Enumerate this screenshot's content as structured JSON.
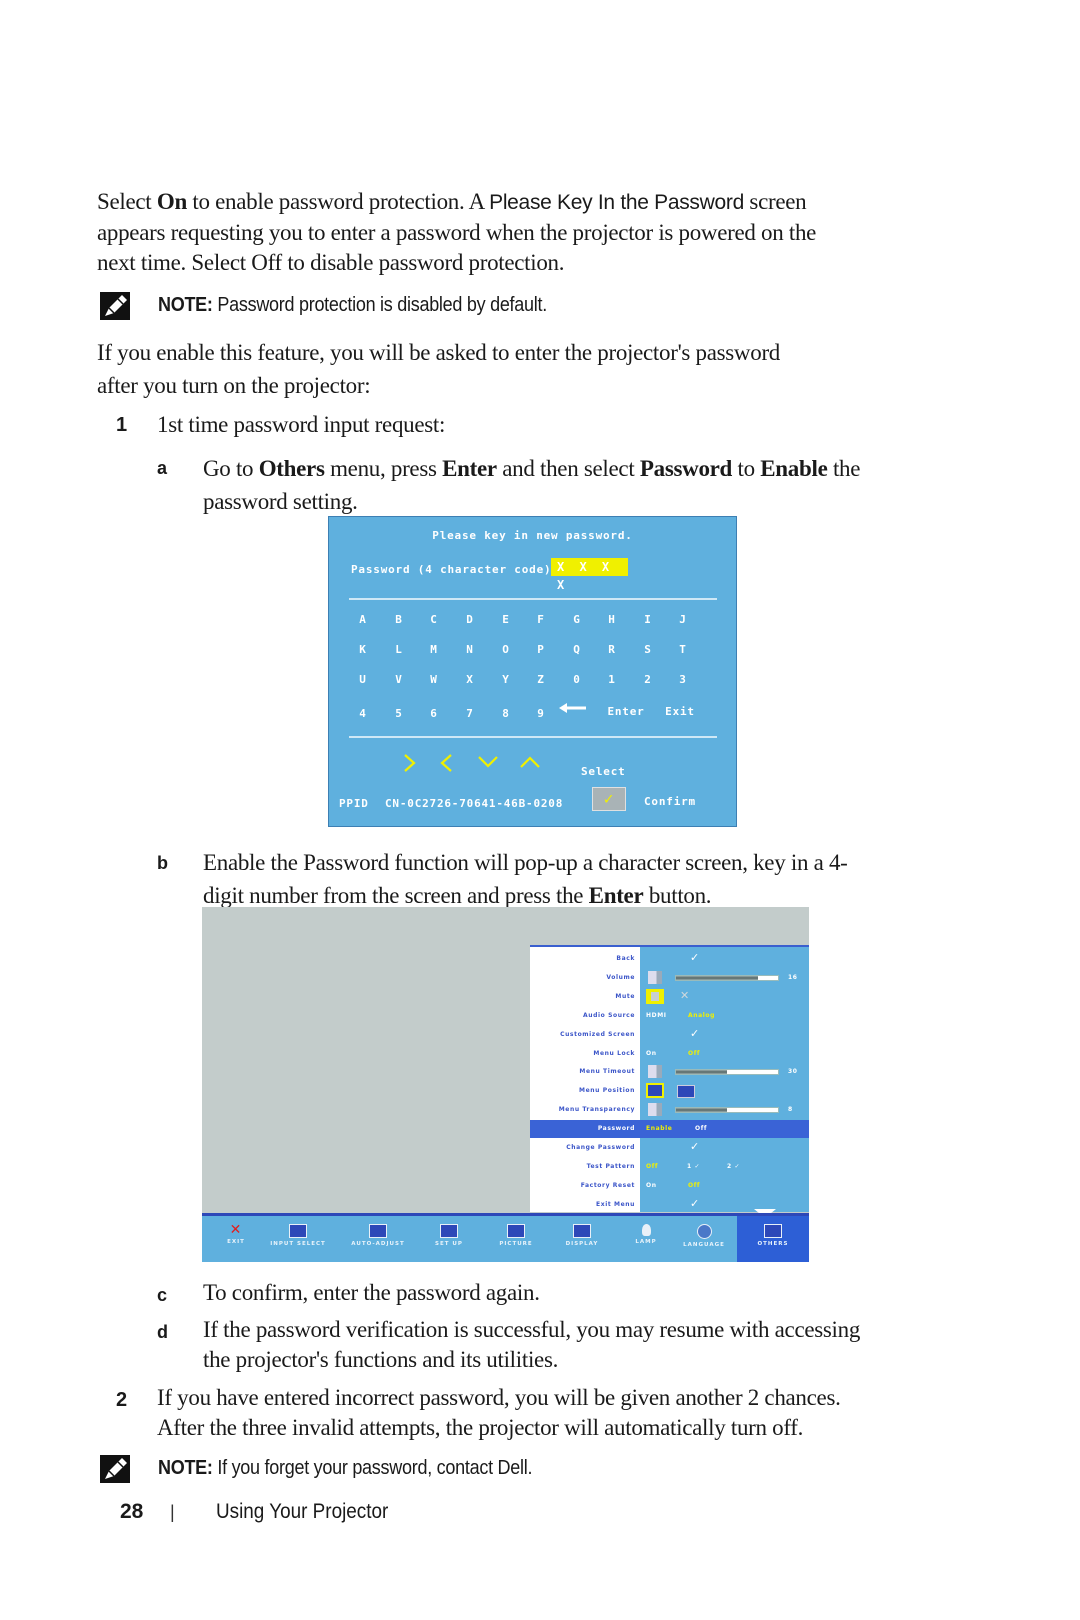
{
  "intro": {
    "line1_pre": "Select ",
    "line1_on": "On",
    "line1_mid": " to enable password protection. A ",
    "line1_ui": "Please Key In the Password",
    "line1_post": " screen",
    "line2": "appears requesting you to enter a password when the projector is powered on the",
    "line3": "next time. Select Off  to disable password protection."
  },
  "note1": {
    "label": "NOTE:",
    "text": " Password protection is disabled by default.",
    "icon": "note-pencil-icon"
  },
  "para2": {
    "line1": "If you enable this feature, you will be asked to enter the projector's password",
    "line2": "after you turn on the projector:"
  },
  "step1": {
    "marker": "1",
    "text": "1st time password input request:",
    "a": {
      "marker": "a",
      "parts": [
        "Go to ",
        "Others",
        " menu, press ",
        "Enter",
        " and then select ",
        "Password",
        " to ",
        "Enable",
        " the"
      ],
      "line2": "password setting."
    },
    "b": {
      "marker": "b",
      "line1": "Enable the Password function will pop-up a character screen, key in a 4-",
      "line2_pre": "digit number from the screen and press the ",
      "line2_bold": "Enter",
      "line2_post": " button."
    },
    "c": {
      "marker": "c",
      "text": "To confirm, enter the password again."
    },
    "d": {
      "marker": "d",
      "line1": "If the password verification is successful, you may resume with accessing",
      "line2": "the projector's functions and its utilities."
    }
  },
  "step2": {
    "marker": "2",
    "line1": "If you have entered incorrect password, you will be given another 2 chances.",
    "line2": "After the three invalid attempts, the projector will automatically turn off."
  },
  "note2": {
    "label": "NOTE:",
    "text": " If you forget your password, contact Dell.",
    "icon": "note-pencil-icon"
  },
  "footer": {
    "page": "28",
    "separator": "|",
    "section": "Using Your Projector"
  },
  "password_dialog": {
    "title": "Please key in new password.",
    "field_label": "Password (4 character code):",
    "field_value": "X X X X",
    "keys": [
      [
        "A",
        "B",
        "C",
        "D",
        "E",
        "F",
        "G",
        "H",
        "I",
        "J"
      ],
      [
        "K",
        "L",
        "M",
        "N",
        "O",
        "P",
        "Q",
        "R",
        "S",
        "T"
      ],
      [
        "U",
        "V",
        "W",
        "X",
        "Y",
        "Z",
        "0",
        "1",
        "2",
        "3"
      ],
      [
        "4",
        "5",
        "6",
        "7",
        "8",
        "9"
      ]
    ],
    "backspace_icon": "left-arrow-icon",
    "enter_label": "Enter",
    "exit_label": "Exit",
    "nav_icons": [
      "right-chevron-icon",
      "left-chevron-icon",
      "down-chevron-icon",
      "up-chevron-icon"
    ],
    "select_label": "Select",
    "ppid_label": "PPID",
    "ppid_value": "CN-0C2726-70641-46B-0208",
    "confirm_icon": "checkmark-icon",
    "confirm_label": "Confirm",
    "colors": {
      "background": "#5fb0de",
      "highlight": "#f0f000"
    }
  },
  "osd_menu": {
    "rows": [
      {
        "label": "Back",
        "check": "✓"
      },
      {
        "label": "Volume",
        "value": "16",
        "level": 0.8
      },
      {
        "label": "Mute"
      },
      {
        "label": "Audio Source",
        "opt1": "HDMI",
        "opt2": "Analog"
      },
      {
        "label": "Customized Screen",
        "check": "✓"
      },
      {
        "label": "Menu Lock",
        "opt1": "On",
        "opt2": "Off"
      },
      {
        "label": "Menu Timeout",
        "value": "30",
        "level": 0.5
      },
      {
        "label": "Menu Position"
      },
      {
        "label": "Menu Transparency",
        "value": "8",
        "level": 0.5
      },
      {
        "label": "Password",
        "opt1": "Enable",
        "opt2": "Off"
      },
      {
        "label": "Change Password",
        "check": "✓"
      },
      {
        "label": "Test Pattern",
        "opt1": "Off",
        "p1": "1 ✓",
        "p2": "2 ✓"
      },
      {
        "label": "Factory Reset",
        "opt1": "On",
        "opt2": "Off"
      },
      {
        "label": "Exit Menu",
        "check": "✓"
      }
    ],
    "tabs": [
      "EXIT",
      "INPUT SELECT",
      "AUTO-ADJUST",
      "SET UP",
      "PICTURE",
      "DISPLAY",
      "LAMP",
      "LANGUAGE",
      "OTHERS"
    ],
    "active_tab": "OTHERS",
    "colors": {
      "menu_bg": "#5fb0de",
      "selected_row": "#3a63d6",
      "label": "#3b55c8",
      "highlight": "#f0f000"
    }
  }
}
